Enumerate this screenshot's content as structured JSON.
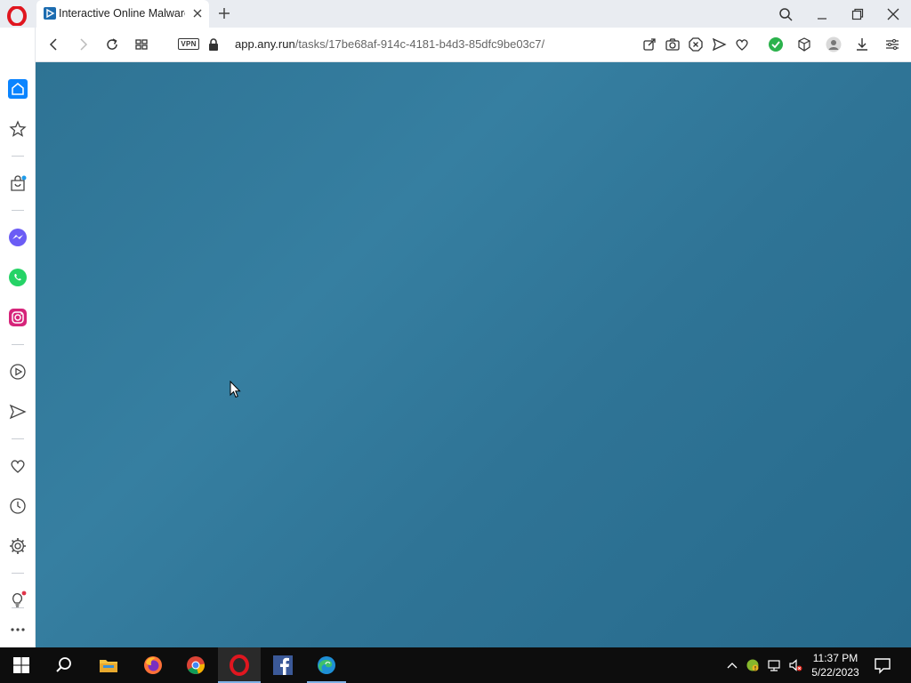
{
  "browser": {
    "tab_title": "Interactive Online Malware",
    "url_host": "app.any.run",
    "url_path": "/tasks/17be68af-914c-4181-b4d3-85dfc9be03c7/",
    "vpn_label": "VPN",
    "accent_color": "#0a84ff"
  },
  "sidebar": {
    "items": [
      {
        "icon": "home-icon"
      },
      {
        "icon": "star-icon"
      },
      {
        "icon": "shopping-bag-icon"
      },
      {
        "icon": "messenger-icon"
      },
      {
        "icon": "whatsapp-icon"
      },
      {
        "icon": "instagram-icon"
      },
      {
        "icon": "player-icon"
      },
      {
        "icon": "send-icon"
      },
      {
        "icon": "heart-icon"
      },
      {
        "icon": "history-icon"
      },
      {
        "icon": "settings-icon"
      },
      {
        "icon": "lightbulb-icon"
      },
      {
        "icon": "more-icon"
      }
    ]
  },
  "content": {
    "background_color": "#2f7697"
  },
  "taskbar": {
    "apps": [
      {
        "icon": "windows-start-icon"
      },
      {
        "icon": "search-icon"
      },
      {
        "icon": "file-explorer-icon"
      },
      {
        "icon": "firefox-icon"
      },
      {
        "icon": "chrome-icon"
      },
      {
        "icon": "opera-icon",
        "active": true
      },
      {
        "icon": "facebook-icon"
      },
      {
        "icon": "edge-icon"
      }
    ],
    "clock_time": "11:37 PM",
    "clock_date": "5/22/2023"
  }
}
